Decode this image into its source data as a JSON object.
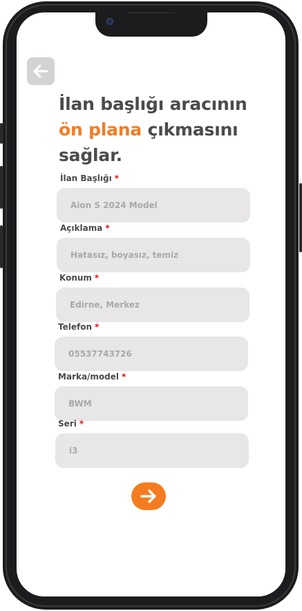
{
  "header": {
    "back_icon": "arrow-left-icon"
  },
  "headline": {
    "line1": "İlan başlığı aracının",
    "accent": "ön plana",
    "line2_rest": " çıkmasını",
    "line3": "sağlar."
  },
  "form": {
    "required_mark": "*",
    "fields": [
      {
        "label": "İlan Başlığı",
        "placeholder": "Aion S 2024 Model"
      },
      {
        "label": "Açıklama",
        "placeholder": "Hatasız, boyasız, temiz"
      },
      {
        "label": "Konum",
        "placeholder": "Edirne, Merkez"
      },
      {
        "label": "Telefon",
        "placeholder": "05537743726"
      },
      {
        "label": "Marka/model",
        "placeholder": "BWM"
      },
      {
        "label": "Seri",
        "placeholder": "i3"
      }
    ]
  },
  "footer": {
    "next_icon": "arrow-right-icon"
  },
  "colors": {
    "accent": "#f47c20",
    "required": "#e01010",
    "field_bg": "#e8e6e6",
    "text": "#4b4b4b"
  }
}
